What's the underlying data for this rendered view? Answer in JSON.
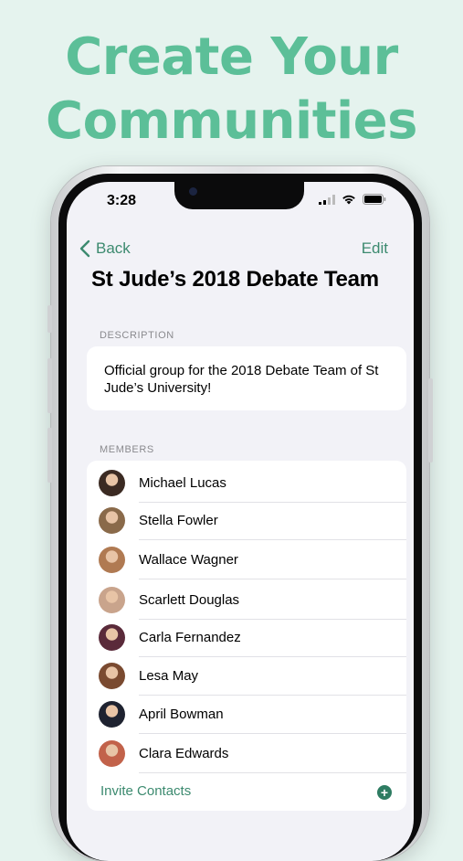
{
  "headline": {
    "line1": "Create Your",
    "line2": "Communities"
  },
  "status_bar": {
    "time": "3:28"
  },
  "nav": {
    "back_label": "Back",
    "edit_label": "Edit"
  },
  "group": {
    "title": "St Jude’s 2018 Debate Team",
    "description_header": "DESCRIPTION",
    "description": "Official group for the 2018 Debate Team of St Jude’s University!"
  },
  "members_header": "MEMBERS",
  "members": [
    {
      "name": "Michael Lucas",
      "avatar_color": "#3b2a22"
    },
    {
      "name": "Stella Fowler",
      "avatar_color": "#8a6a4a"
    },
    {
      "name": "Wallace Wagner",
      "avatar_color": "#b07a52"
    },
    {
      "name": "Scarlett Douglas",
      "avatar_color": "#c9a48c"
    },
    {
      "name": "Carla Fernandez",
      "avatar_color": "#5a2a3a"
    },
    {
      "name": "Lesa May",
      "avatar_color": "#7a4a30"
    },
    {
      "name": "April Bowman",
      "avatar_color": "#1e2230"
    },
    {
      "name": "Clara Edwards",
      "avatar_color": "#c2624a"
    }
  ],
  "invite_label": "Invite Contacts",
  "colors": {
    "accent": "#3c8a6f",
    "headline": "#5cbf98",
    "background": "#e5f3ee"
  }
}
